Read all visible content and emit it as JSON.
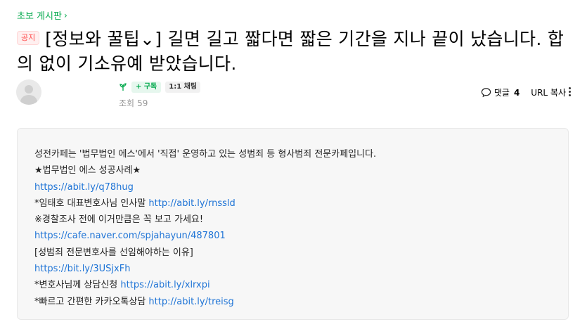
{
  "board": {
    "name": "초보 게시판",
    "chevron": "›"
  },
  "post": {
    "badge": "공지",
    "title": "[정보와 꿀팁⌄] 길면 길고 짧다면 짧은 기간을 지나 끝이 났습니다. 합의 없이 기소유예 받았습니다."
  },
  "author": {
    "subscribe_label": "+ 구독",
    "chat_label": "1:1 채팅",
    "views_label": "조회",
    "views_count": "59"
  },
  "toolbar": {
    "comment_label": "댓글",
    "comment_count": "4",
    "url_copy_label": "URL 복사"
  },
  "content": {
    "line1": "성전카페는 '법무법인 에스'에서 '직접' 운영하고 있는 성범죄 등 형사범죄 전문카페입니다.",
    "line2": "★법무법인 에스 성공사례★",
    "line3_link": "https://abit.ly/q78hug",
    "line4_text": "*임태호 대표변호사님 인사말 ",
    "line4_link": "http://abit.ly/rnssld",
    "line5": "※경찰조사 전에 이거만큼은 꼭 보고 가세요!",
    "line6_link": "https://cafe.naver.com/spjahayun/487801",
    "line7": "[성범죄 전문변호사를 선임해야하는 이유]",
    "line8_link": "https://bit.ly/3USjxFh",
    "line9_text": "*변호사님께 상담신청 ",
    "line9_link": "https://abit.ly/xlrxpi",
    "line10_text": "*빠르고 간편한 카카오톡상담 ",
    "line10_link": "http://abit.ly/treisg"
  },
  "colors": {
    "accent": "#03a94d",
    "link": "#1f74d6",
    "badge": "#ff4a4a"
  },
  "icons": [
    "leaf-icon",
    "comment-icon",
    "more-icon",
    "avatar-placeholder-icon",
    "chevron-right-icon"
  ]
}
